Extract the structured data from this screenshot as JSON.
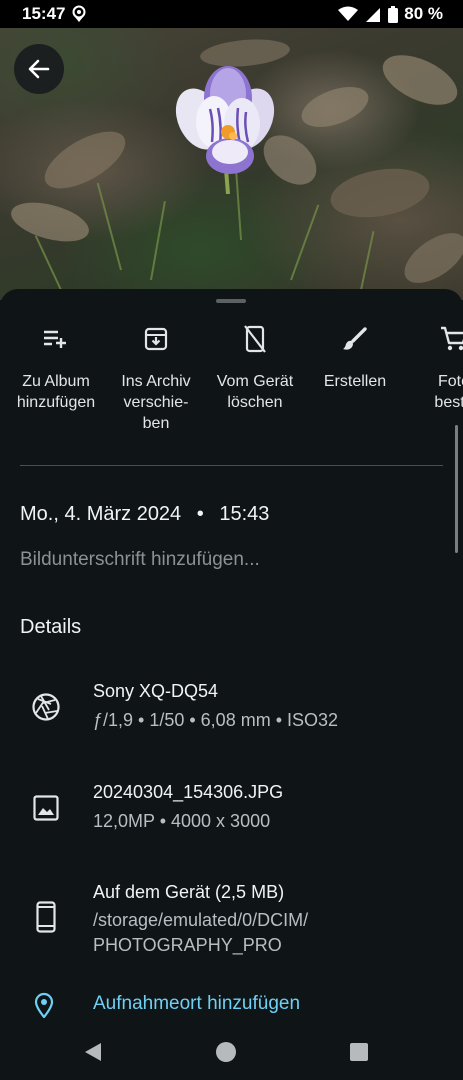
{
  "status_bar": {
    "time": "15:47",
    "battery": "80 %",
    "icons": [
      "location-pin-icon",
      "wifi-icon",
      "signal-icon",
      "battery-icon"
    ]
  },
  "photo": {
    "description_icon": "crocus-photo",
    "back_icon": "arrow-back-icon"
  },
  "actions": [
    {
      "icon": "playlist-add-icon",
      "label": "Zu Album\nhinzufügen"
    },
    {
      "icon": "archive-icon",
      "label": "Ins Archiv\nverschie-\nben"
    },
    {
      "icon": "phone-erase-icon",
      "label": "Vom Gerät\nlöschen"
    },
    {
      "icon": "brush-icon",
      "label": "Erstellen"
    },
    {
      "icon": "cart-icon",
      "label": "Foto\nbeste"
    }
  ],
  "info": {
    "date": "Mo., 4. März 2024",
    "separator": "•",
    "time": "15:43",
    "caption_placeholder": "Bildunterschrift hinzufügen..."
  },
  "details": {
    "heading": "Details",
    "camera": {
      "icon": "aperture-icon",
      "title": "Sony XQ-DQ54",
      "sub": "ƒ/1,9  •  1/50  •  6,08 mm  •  ISO32"
    },
    "file": {
      "icon": "image-icon",
      "title": "20240304_154306.JPG",
      "sub": "12,0MP  •  4000 x 3000"
    },
    "storage": {
      "icon": "smartphone-icon",
      "title": "Auf dem Gerät (2,5 MB)",
      "sub_line1": "/storage/emulated/0/DCIM/",
      "sub_line2": "PHOTOGRAPHY_PRO"
    },
    "location": {
      "icon": "location-pin-icon",
      "label": "Aufnahmeort hinzufügen",
      "color": "#6fd0f5"
    }
  },
  "navbar": {
    "icons": [
      "nav-back-icon",
      "nav-home-icon",
      "nav-recents-icon"
    ]
  }
}
